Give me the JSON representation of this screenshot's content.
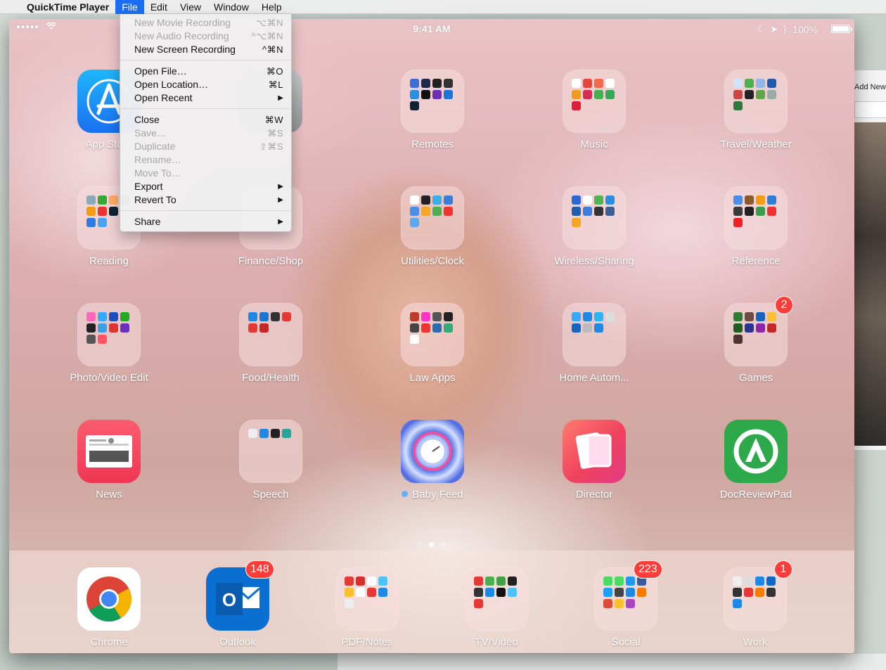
{
  "menubar": {
    "app_name": "QuickTime Player",
    "items": [
      "File",
      "Edit",
      "View",
      "Window",
      "Help"
    ]
  },
  "file_menu": {
    "items": [
      {
        "label": "New Movie Recording",
        "shortcut": "⌥⌘N",
        "enabled": false
      },
      {
        "label": "New Audio Recording",
        "shortcut": "^⌥⌘N",
        "enabled": false
      },
      {
        "label": "New Screen Recording",
        "shortcut": "^⌘N",
        "enabled": true
      },
      {
        "label": "Open File…",
        "shortcut": "⌘O",
        "enabled": true
      },
      {
        "label": "Open Location…",
        "shortcut": "⌘L",
        "enabled": true
      },
      {
        "label": "Open Recent",
        "shortcut": "▶",
        "enabled": true
      },
      {
        "label": "Close",
        "shortcut": "⌘W",
        "enabled": true
      },
      {
        "label": "Save…",
        "shortcut": "⌘S",
        "enabled": false
      },
      {
        "label": "Duplicate",
        "shortcut": "⇧⌘S",
        "enabled": false
      },
      {
        "label": "Rename…",
        "shortcut": "",
        "enabled": false
      },
      {
        "label": "Move To…",
        "shortcut": "",
        "enabled": false
      },
      {
        "label": "Export",
        "shortcut": "▶",
        "enabled": true
      },
      {
        "label": "Revert To",
        "shortcut": "▶",
        "enabled": true
      },
      {
        "label": "Share",
        "shortcut": "▶",
        "enabled": true
      }
    ]
  },
  "background_window": {
    "add_new": "Add New"
  },
  "ipad": {
    "status": {
      "time": "9:41 AM",
      "battery": "100%"
    },
    "apps": [
      {
        "label": "App Store"
      },
      {
        "label": "Remotes"
      },
      {
        "label": "Music"
      },
      {
        "label": "Travel/Weather"
      },
      {
        "label": "Reading"
      },
      {
        "label": "Finance/Shop"
      },
      {
        "label": "Utilities/Clock"
      },
      {
        "label": "Wireless/Sharing"
      },
      {
        "label": "Reference"
      },
      {
        "label": "Photo/Video Edit"
      },
      {
        "label": "Food/Health"
      },
      {
        "label": "Law Apps"
      },
      {
        "label": "Home Autom..."
      },
      {
        "label": "Games",
        "badge": "2"
      },
      {
        "label": "News"
      },
      {
        "label": "Speech"
      },
      {
        "label": "Baby Feed"
      },
      {
        "label": "Director"
      },
      {
        "label": "DocReviewPad"
      }
    ],
    "dock": [
      {
        "label": "Chrome"
      },
      {
        "label": "Outlook",
        "badge": "148"
      },
      {
        "label": "PDF/Notes"
      },
      {
        "label": "TV/Video"
      },
      {
        "label": "Social",
        "badge": "223"
      },
      {
        "label": "Work",
        "badge": "1"
      }
    ]
  },
  "colors": {
    "menu_highlight": "#1b6ef3",
    "badge": "#fc3d39",
    "appstore": "#1e96f5",
    "outlook": "#0a6fd1",
    "docreview": "#2da84a",
    "director": "#f0505e",
    "news": "#f3455a"
  }
}
